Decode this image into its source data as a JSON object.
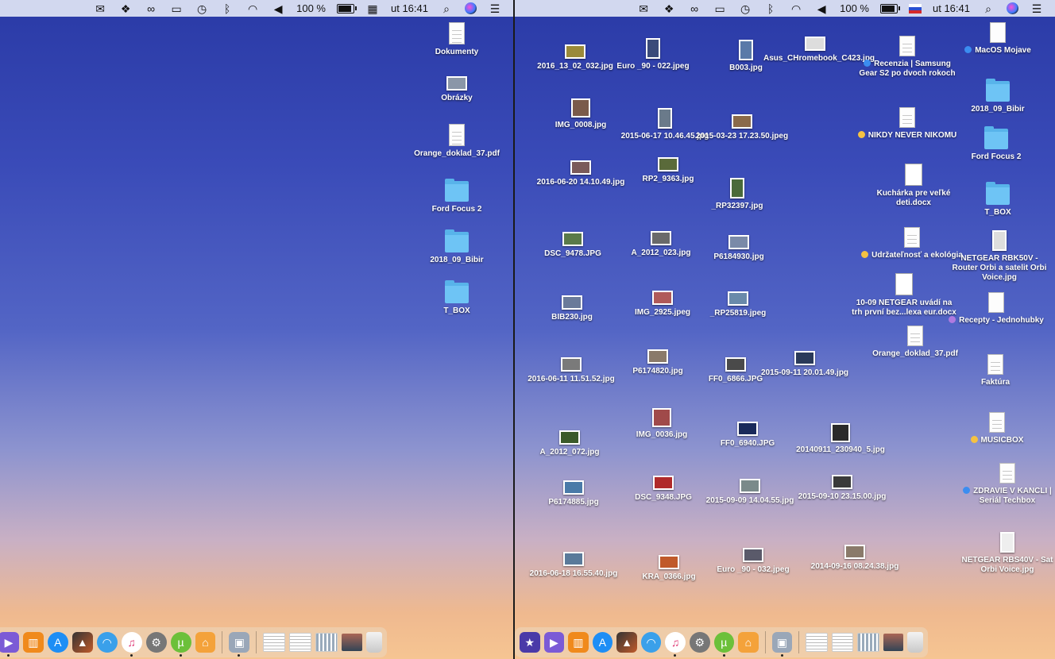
{
  "menubar": {
    "battery": "100 %",
    "clock": "ut 16:41"
  },
  "left_desktop": {
    "items": [
      {
        "label": "Dokumenty"
      },
      {
        "label": "Obrázky"
      },
      {
        "label": "Orange_doklad_37.pdf"
      },
      {
        "label": "Ford Focus 2"
      },
      {
        "label": "2018_09_Bibir"
      },
      {
        "label": "T_BOX"
      }
    ]
  },
  "right_desktop": {
    "photos": [
      "2016_13_02_032.jpg",
      "Euro _90 - 022.jpeg",
      "B003.jpg",
      "Asus_CHromebook_C423.jpg",
      "IMG_0008.jpg",
      "2015-06-17 10.46.45.jpg",
      "2015-03-23 17.23.50.jpeg",
      "2016-06-20 14.10.49.jpg",
      "RP2_9363.jpg",
      "_RP32397.jpg",
      "DSC_9478.JPG",
      "A_2012_023.jpg",
      "P6184930.jpg",
      "BIB230.jpg",
      "IMG_2925.jpeg",
      "_RP25819.jpeg",
      "2016-06-11 11.51.52.jpg",
      "P6174820.jpg",
      "FF0_6866.JPG",
      "2015-09-11 20.01.49.jpg",
      "A_2012_072.jpg",
      "IMG_0036.jpg",
      "FF0_6940.JPG",
      "20140911_230940_5.jpg",
      "P6174885.jpg",
      "DSC_9348.JPG",
      "2015-09-09 14.04.55.jpg",
      "2015-09-10 23.15.00.jpg",
      "2016-06-18 16.55.40.jpg",
      "KRA_0366.jpg",
      "Euro _90 - 032.jpeg",
      "2014-09-16 08.24.38.jpg"
    ],
    "documents": [
      "Recenzia | Samsung Gear S2 po dvoch rokoch",
      "NIKDY NEVER NIKOMU",
      "Kuchárka pre veľké deti.docx",
      "Udržateľnosť a ekológia",
      "10-09 NETGEAR uvádí na trh první bez...lexa eur.docx",
      "Orange_doklad_37.pdf"
    ],
    "column": [
      "MacOS Mojave",
      "2018_09_Bibir",
      "Ford Focus 2",
      "T_BOX",
      "NETGEAR RBK50V - Router Orbi a satelit Orbi Voice.jpg",
      "Recepty - Jednohubky",
      "Faktúra",
      "MUSICBOX",
      "ZDRAVIE V KANCLI | Seriál Techbox",
      "NETGEAR RBS40V - Sat Orbi Voice.jpg"
    ]
  },
  "tag_colors": {
    "blue": "#3b8df0",
    "yellow": "#f5c242",
    "purple": "#b07ae0"
  },
  "dock_icons": [
    "imovie-icon",
    "garageband-icon",
    "books-icon",
    "app-store-icon",
    "directory-icon",
    "wifi-utility-icon",
    "itunes-icon",
    "system-preferences-icon",
    "utorrent-icon",
    "home-icon",
    "preview-icon",
    "document-stack-icon",
    "trash-icon"
  ]
}
